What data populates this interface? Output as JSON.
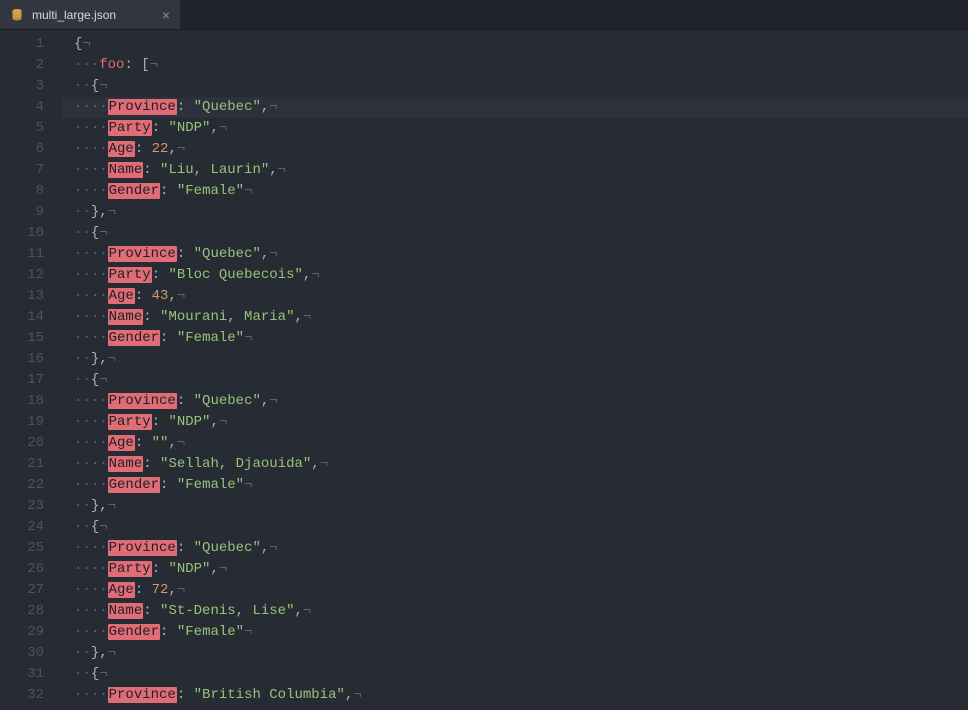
{
  "tab": {
    "filename": "multi_large.json",
    "close_glyph": "×"
  },
  "editor": {
    "lines": [
      {
        "n": 1,
        "indent": 0,
        "segs": [
          {
            "t": "punct",
            "v": "{"
          },
          {
            "t": "inv",
            "v": "¬"
          }
        ]
      },
      {
        "n": 2,
        "indent": 1,
        "segs": [
          {
            "t": "inv",
            "v": "·"
          },
          {
            "t": "prop",
            "v": "foo"
          },
          {
            "t": "colon",
            "v": ": "
          },
          {
            "t": "punct",
            "v": "["
          },
          {
            "t": "inv",
            "v": "¬"
          }
        ]
      },
      {
        "n": 3,
        "indent": 1,
        "segs": [
          {
            "t": "punct",
            "v": "{"
          },
          {
            "t": "inv",
            "v": "¬"
          }
        ]
      },
      {
        "n": 4,
        "indent": 2,
        "hl": true,
        "segs": [
          {
            "t": "key",
            "v": "Province"
          },
          {
            "t": "colon",
            "v": ": "
          },
          {
            "t": "str",
            "v": "\"Quebec\""
          },
          {
            "t": "punct",
            "v": ","
          },
          {
            "t": "inv",
            "v": "¬"
          }
        ]
      },
      {
        "n": 5,
        "indent": 2,
        "segs": [
          {
            "t": "key",
            "v": "Party"
          },
          {
            "t": "colon",
            "v": ": "
          },
          {
            "t": "str",
            "v": "\"NDP\""
          },
          {
            "t": "punct",
            "v": ","
          },
          {
            "t": "inv",
            "v": "¬"
          }
        ]
      },
      {
        "n": 6,
        "indent": 2,
        "segs": [
          {
            "t": "key",
            "v": "Age"
          },
          {
            "t": "colon",
            "v": ": "
          },
          {
            "t": "num",
            "v": "22"
          },
          {
            "t": "punct",
            "v": ","
          },
          {
            "t": "inv",
            "v": "¬"
          }
        ]
      },
      {
        "n": 7,
        "indent": 2,
        "segs": [
          {
            "t": "key",
            "v": "Name"
          },
          {
            "t": "colon",
            "v": ": "
          },
          {
            "t": "str",
            "v": "\"Liu, Laurin\""
          },
          {
            "t": "punct",
            "v": ","
          },
          {
            "t": "inv",
            "v": "¬"
          }
        ]
      },
      {
        "n": 8,
        "indent": 2,
        "segs": [
          {
            "t": "key",
            "v": "Gender"
          },
          {
            "t": "colon",
            "v": ": "
          },
          {
            "t": "str",
            "v": "\"Female\""
          },
          {
            "t": "inv",
            "v": "¬"
          }
        ]
      },
      {
        "n": 9,
        "indent": 1,
        "segs": [
          {
            "t": "punct",
            "v": "},"
          },
          {
            "t": "inv",
            "v": "¬"
          }
        ]
      },
      {
        "n": 10,
        "indent": 1,
        "segs": [
          {
            "t": "punct",
            "v": "{"
          },
          {
            "t": "inv",
            "v": "¬"
          }
        ]
      },
      {
        "n": 11,
        "indent": 2,
        "segs": [
          {
            "t": "key",
            "v": "Province"
          },
          {
            "t": "colon",
            "v": ": "
          },
          {
            "t": "str",
            "v": "\"Quebec\""
          },
          {
            "t": "punct",
            "v": ","
          },
          {
            "t": "inv",
            "v": "¬"
          }
        ]
      },
      {
        "n": 12,
        "indent": 2,
        "segs": [
          {
            "t": "key",
            "v": "Party"
          },
          {
            "t": "colon",
            "v": ": "
          },
          {
            "t": "str",
            "v": "\"Bloc Quebecois\""
          },
          {
            "t": "punct",
            "v": ","
          },
          {
            "t": "inv",
            "v": "¬"
          }
        ]
      },
      {
        "n": 13,
        "indent": 2,
        "segs": [
          {
            "t": "key",
            "v": "Age"
          },
          {
            "t": "colon",
            "v": ": "
          },
          {
            "t": "num",
            "v": "43"
          },
          {
            "t": "punct",
            "v": ","
          },
          {
            "t": "inv",
            "v": "¬"
          }
        ]
      },
      {
        "n": 14,
        "indent": 2,
        "segs": [
          {
            "t": "key",
            "v": "Name"
          },
          {
            "t": "colon",
            "v": ": "
          },
          {
            "t": "str",
            "v": "\"Mourani, Maria\""
          },
          {
            "t": "punct",
            "v": ","
          },
          {
            "t": "inv",
            "v": "¬"
          }
        ]
      },
      {
        "n": 15,
        "indent": 2,
        "segs": [
          {
            "t": "key",
            "v": "Gender"
          },
          {
            "t": "colon",
            "v": ": "
          },
          {
            "t": "str",
            "v": "\"Female\""
          },
          {
            "t": "inv",
            "v": "¬"
          }
        ]
      },
      {
        "n": 16,
        "indent": 1,
        "segs": [
          {
            "t": "punct",
            "v": "},"
          },
          {
            "t": "inv",
            "v": "¬"
          }
        ]
      },
      {
        "n": 17,
        "indent": 1,
        "segs": [
          {
            "t": "punct",
            "v": "{"
          },
          {
            "t": "inv",
            "v": "¬"
          }
        ]
      },
      {
        "n": 18,
        "indent": 2,
        "segs": [
          {
            "t": "key",
            "v": "Province"
          },
          {
            "t": "colon",
            "v": ": "
          },
          {
            "t": "str",
            "v": "\"Quebec\""
          },
          {
            "t": "punct",
            "v": ","
          },
          {
            "t": "inv",
            "v": "¬"
          }
        ]
      },
      {
        "n": 19,
        "indent": 2,
        "segs": [
          {
            "t": "key",
            "v": "Party"
          },
          {
            "t": "colon",
            "v": ": "
          },
          {
            "t": "str",
            "v": "\"NDP\""
          },
          {
            "t": "punct",
            "v": ","
          },
          {
            "t": "inv",
            "v": "¬"
          }
        ]
      },
      {
        "n": 20,
        "indent": 2,
        "segs": [
          {
            "t": "key",
            "v": "Age"
          },
          {
            "t": "colon",
            "v": ": "
          },
          {
            "t": "str",
            "v": "\"\""
          },
          {
            "t": "punct",
            "v": ","
          },
          {
            "t": "inv",
            "v": "¬"
          }
        ]
      },
      {
        "n": 21,
        "indent": 2,
        "segs": [
          {
            "t": "key",
            "v": "Name"
          },
          {
            "t": "colon",
            "v": ": "
          },
          {
            "t": "str",
            "v": "\"Sellah, Djaouida\""
          },
          {
            "t": "punct",
            "v": ","
          },
          {
            "t": "inv",
            "v": "¬"
          }
        ]
      },
      {
        "n": 22,
        "indent": 2,
        "segs": [
          {
            "t": "key",
            "v": "Gender"
          },
          {
            "t": "colon",
            "v": ": "
          },
          {
            "t": "str",
            "v": "\"Female\""
          },
          {
            "t": "inv",
            "v": "¬"
          }
        ]
      },
      {
        "n": 23,
        "indent": 1,
        "segs": [
          {
            "t": "punct",
            "v": "},"
          },
          {
            "t": "inv",
            "v": "¬"
          }
        ]
      },
      {
        "n": 24,
        "indent": 1,
        "segs": [
          {
            "t": "punct",
            "v": "{"
          },
          {
            "t": "inv",
            "v": "¬"
          }
        ]
      },
      {
        "n": 25,
        "indent": 2,
        "segs": [
          {
            "t": "key",
            "v": "Province"
          },
          {
            "t": "colon",
            "v": ": "
          },
          {
            "t": "str",
            "v": "\"Quebec\""
          },
          {
            "t": "punct",
            "v": ","
          },
          {
            "t": "inv",
            "v": "¬"
          }
        ]
      },
      {
        "n": 26,
        "indent": 2,
        "segs": [
          {
            "t": "key",
            "v": "Party"
          },
          {
            "t": "colon",
            "v": ": "
          },
          {
            "t": "str",
            "v": "\"NDP\""
          },
          {
            "t": "punct",
            "v": ","
          },
          {
            "t": "inv",
            "v": "¬"
          }
        ]
      },
      {
        "n": 27,
        "indent": 2,
        "segs": [
          {
            "t": "key",
            "v": "Age"
          },
          {
            "t": "colon",
            "v": ": "
          },
          {
            "t": "num",
            "v": "72"
          },
          {
            "t": "punct",
            "v": ","
          },
          {
            "t": "inv",
            "v": "¬"
          }
        ]
      },
      {
        "n": 28,
        "indent": 2,
        "segs": [
          {
            "t": "key",
            "v": "Name"
          },
          {
            "t": "colon",
            "v": ": "
          },
          {
            "t": "str",
            "v": "\"St-Denis, Lise\""
          },
          {
            "t": "punct",
            "v": ","
          },
          {
            "t": "inv",
            "v": "¬"
          }
        ]
      },
      {
        "n": 29,
        "indent": 2,
        "segs": [
          {
            "t": "key",
            "v": "Gender"
          },
          {
            "t": "colon",
            "v": ": "
          },
          {
            "t": "str",
            "v": "\"Female\""
          },
          {
            "t": "inv",
            "v": "¬"
          }
        ]
      },
      {
        "n": 30,
        "indent": 1,
        "segs": [
          {
            "t": "punct",
            "v": "},"
          },
          {
            "t": "inv",
            "v": "¬"
          }
        ]
      },
      {
        "n": 31,
        "indent": 1,
        "segs": [
          {
            "t": "punct",
            "v": "{"
          },
          {
            "t": "inv",
            "v": "¬"
          }
        ]
      },
      {
        "n": 32,
        "indent": 2,
        "segs": [
          {
            "t": "key",
            "v": "Province"
          },
          {
            "t": "colon",
            "v": ": "
          },
          {
            "t": "str",
            "v": "\"British Columbia\""
          },
          {
            "t": "punct",
            "v": ","
          },
          {
            "t": "inv",
            "v": "¬"
          }
        ]
      }
    ]
  }
}
